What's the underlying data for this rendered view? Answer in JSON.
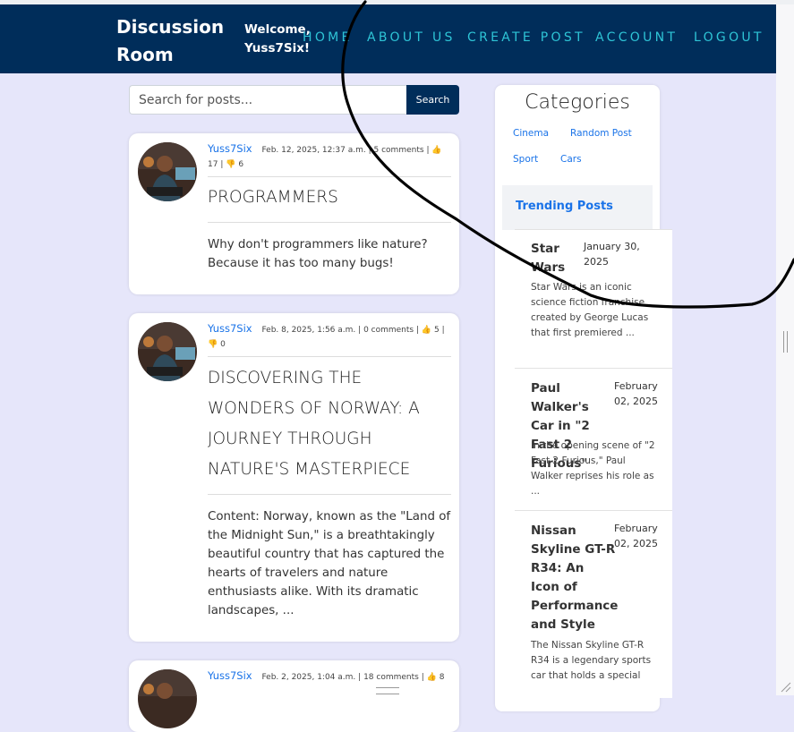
{
  "brand": {
    "line1": "Discussion",
    "line2": "Room"
  },
  "welcome": {
    "line1": "Welcome,",
    "line2": "Yuss7Six!"
  },
  "nav": {
    "home": "HOME",
    "about": "ABOUT US",
    "create": "CREATE POST",
    "account": "ACCOUNT",
    "logout": "LOGOUT"
  },
  "search": {
    "placeholder": "Search for posts...",
    "button": "Search"
  },
  "posts": [
    {
      "author": "Yuss7Six",
      "date": "Feb. 12, 2025, 12:37 a.m.",
      "comments": "5 comments",
      "likes": "17",
      "dislikes": "6",
      "title": "PROGRAMMERS",
      "body": "Why don't programmers like nature? Because it has too many bugs!"
    },
    {
      "author": "Yuss7Six",
      "date": "Feb. 8, 2025, 1:56 a.m.",
      "comments": "0 comments",
      "likes": "5",
      "dislikes": "0",
      "title": "DISCOVERING THE WONDERS OF NORWAY: A JOURNEY THROUGH NATURE'S MASTERPIECE",
      "body": "Content: Norway, known as the \"Land of the Midnight Sun,\" is a breathtakingly beautiful country that has captured the hearts of travelers and nature enthusiasts alike. With its dramatic landscapes, ..."
    },
    {
      "author": "Yuss7Six",
      "date": "Feb. 2, 2025, 1:04 a.m.",
      "comments": "18 comments",
      "likes": "8"
    }
  ],
  "sidebar": {
    "title": "Categories",
    "categories": [
      "Cinema",
      "Random Post",
      "Sport",
      "Cars"
    ],
    "trending_title": "Trending Posts",
    "trending": [
      {
        "title": "Star Wars",
        "date": "January 30, 2025",
        "snippet": "Star Wars is an iconic science fiction franchise created by George Lucas that first premiered ..."
      },
      {
        "title": "Paul Walker's Car in \"2 Fast 2 Furious\"",
        "date": "February 02, 2025",
        "snippet": "In the opening scene of \"2 Fast 2 Furious,\" Paul Walker reprises his role as ..."
      },
      {
        "title": "Nissan Skyline GT-R R34: An Icon of Performance and Style",
        "date": "February 02, 2025",
        "snippet": "The Nissan Skyline GT-R R34 is a legendary sports car that holds a special"
      }
    ]
  },
  "colors": {
    "navbar": "#002d5a",
    "nav_link": "#2ec4d6",
    "page_bg": "#e6e6fa",
    "link_blue": "#1a73e8"
  },
  "icons": [
    "thumbs-up-icon",
    "thumbs-down-icon"
  ]
}
